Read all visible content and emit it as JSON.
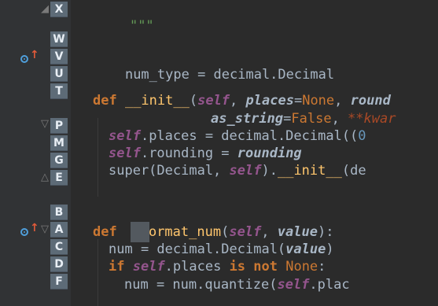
{
  "letters": [
    "X",
    "W",
    "V",
    "U",
    "T",
    "P",
    "M",
    "G",
    "E",
    "B",
    "A",
    "C",
    "D",
    "F"
  ],
  "colors": {
    "background": "#2b2b2b",
    "gutter": "#313335",
    "letter_badge": "#5d6b77",
    "keyword": "#cc7832",
    "function": "#ffc66d",
    "self": "#94558d",
    "number": "#6897bb",
    "string": "#629755",
    "icon_blue": "#4f9fdb",
    "icon_red": "#e05a3a"
  },
  "icons": {
    "override": "override-icon",
    "fold": "fold-marker-icon"
  },
  "code": {
    "l0": {
      "doc": "\"\"\""
    },
    "l2": {
      "a": "num_type = decimal.Decimal"
    },
    "l4": {
      "def": "def ",
      "name": "__init__",
      "open": "(",
      "self": "self",
      "sep1": ", ",
      "p1": "places",
      "eq1": "=",
      "none1": "None",
      "sep2": ", ",
      "p2": "round"
    },
    "l5": {
      "p": "as_string",
      "eq": "=",
      "false": "False",
      "sep": ", ",
      "kw": "**kwar"
    },
    "l6": {
      "self": "self",
      "mid": ".places = decimal.Decimal((",
      "num": "0"
    },
    "l7": {
      "self": "self",
      "mid": ".rounding = ",
      "p": "rounding"
    },
    "l8": {
      "super": "super(Decimal, ",
      "self": "self",
      "dot": ").",
      "init": "__init__",
      "rest": "(de"
    },
    "l10": {
      "def": "def ",
      "name": "ormat_num",
      "open": "(",
      "self": "self",
      "sep": ", ",
      "p": "value",
      "close": "):"
    },
    "l11": {
      "a": "num = decimal.Decimal(",
      "p": "value",
      "b": ")"
    },
    "l12": {
      "if": "if ",
      "self": "self",
      "mid": ".places ",
      "is": "is not ",
      "none": "None",
      "colon": ":"
    },
    "l13": {
      "a": "num = num.quantize(",
      "self": "self",
      "b": ".plac"
    }
  }
}
